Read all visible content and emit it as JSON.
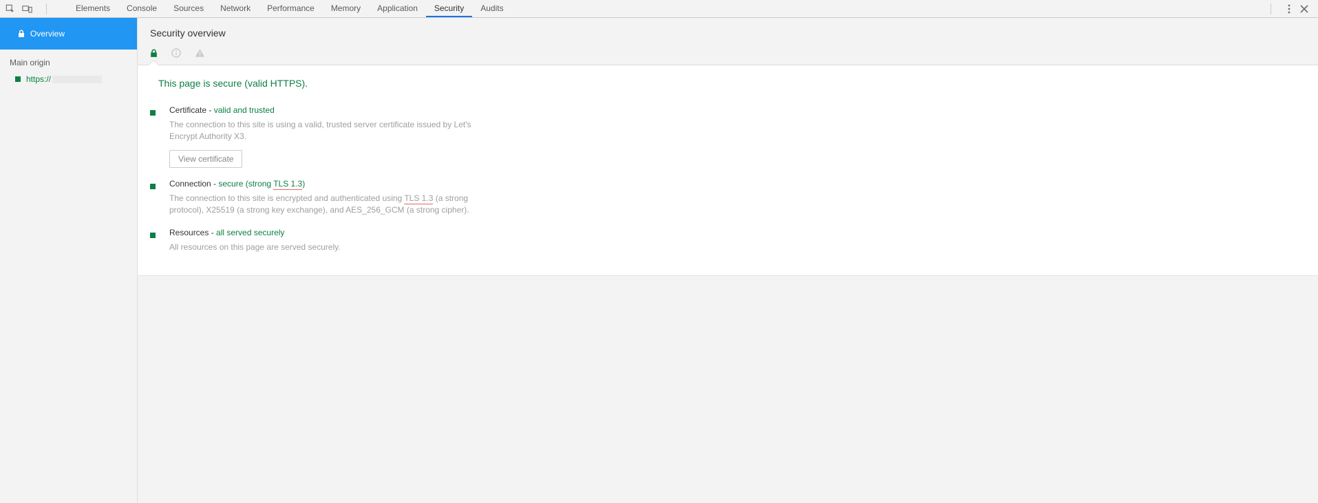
{
  "tabs": {
    "items": [
      "Elements",
      "Console",
      "Sources",
      "Network",
      "Performance",
      "Memory",
      "Application",
      "Security",
      "Audits"
    ],
    "active": "Security"
  },
  "sidebar": {
    "overview_label": "Overview",
    "section_label": "Main origin",
    "origin_scheme": "https://"
  },
  "header": {
    "title": "Security overview"
  },
  "overview": {
    "headline": "This page is secure (valid HTTPS).",
    "certificate": {
      "title_prefix": "Certificate - ",
      "title_status": "valid and trusted",
      "desc": "The connection to this site is using a valid, trusted server certificate issued by Let's Encrypt Authority X3.",
      "button": "View certificate"
    },
    "connection": {
      "title_prefix": "Connection - ",
      "title_status_pre": "secure (strong ",
      "title_status_tls": "TLS 1.3",
      "title_status_post": ")",
      "desc_pre": "The connection to this site is encrypted and authenticated using ",
      "desc_tls": "TLS 1.3",
      "desc_post": " (a strong protocol), X25519 (a strong key exchange), and AES_256_GCM (a strong cipher)."
    },
    "resources": {
      "title_prefix": "Resources - ",
      "title_status": "all served securely",
      "desc": "All resources on this page are served securely."
    }
  }
}
